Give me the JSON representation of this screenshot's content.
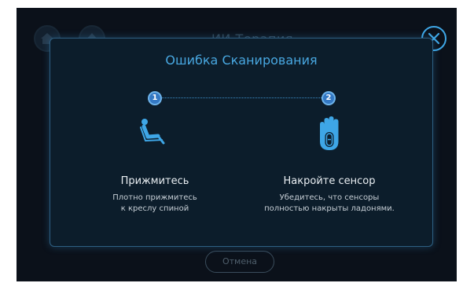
{
  "background": {
    "title": "ИИ Терапия",
    "cancel_label": "Отмена"
  },
  "dialog": {
    "title": "Ошибка Сканирования",
    "steps": [
      {
        "number": "1",
        "icon": "seat-recline-icon",
        "title": "Прижмитесь",
        "desc_line1": "Плотно прижмитесь",
        "desc_line2": "к креслу спиной"
      },
      {
        "number": "2",
        "icon": "hand-sensor-icon",
        "title": "Накройте сенсор",
        "desc_line1": "Убедитесь, что сенсоры",
        "desc_line2": "полностью накрыты ладонями."
      }
    ]
  },
  "colors": {
    "accent": "#48a7e0",
    "background": "#0b111a",
    "dialog_background": "#0c1d2b",
    "dialog_border": "#2e5f82",
    "step_badge": "#3478c3",
    "text": "#e9eef2"
  }
}
